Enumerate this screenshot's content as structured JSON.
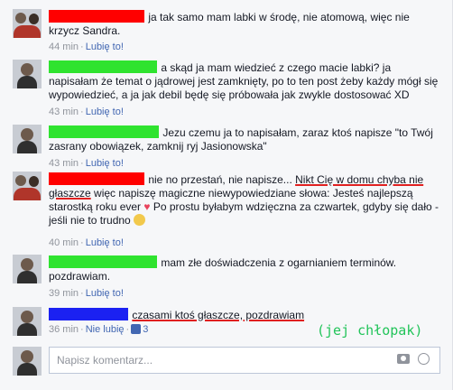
{
  "comments": [
    {
      "text": "ja tak samo mam labki w środę, nie atomową, więc nie krzycz Sandra.",
      "time": "44 min",
      "like_label": "Lubię to!"
    },
    {
      "text": "a skąd ja mam wiedzieć z czego macie labki? ja napisałam że temat o jądrowej jest zamknięty, po to ten post żeby każdy mógł się wypowiedzieć, a ja jak debil będę się próbowała jak zwykle dostosować XD",
      "time": "43 min",
      "like_label": "Lubię to!"
    },
    {
      "text": "Jezu czemu ja to napisałam, zaraz ktoś napisze \"to Twój zasrany obowiązek, zamknij ryj Jasionowska\"",
      "time": "43 min",
      "like_label": "Lubię to!"
    },
    {
      "text_before": "nie no przestań, nie napisze... ",
      "text_underlined": "Nikt Cię w domu chyba nie głaszcze",
      "text_after": " więc napiszę magiczne niewypowiedziane słowa: Jesteś najlepszą starostką roku ever",
      "text_after_heart": " Po prostu byłabym wdzięczna za czwartek, gdyby się dało - jeśli nie to trudno",
      "time": "40 min",
      "like_label": "Lubię to!"
    },
    {
      "text": "mam złe doświadczenia z ogarnianiem terminów. pozdrawiam.",
      "time": "39 min",
      "like_label": "Lubię to!"
    },
    {
      "text": "czasami ktoś głaszcze, pozdrawiam",
      "time": "36 min",
      "unlike_label": "Nie lubię",
      "likes_count": "3"
    }
  ],
  "annotation": "(jej chłopak)",
  "composer": {
    "placeholder": "Napisz komentarz..."
  },
  "icons": {
    "camera": "camera-icon",
    "emoji": "emoji-icon",
    "heart": "heart-icon",
    "thumb": "thumbs-up-icon"
  },
  "colors": {
    "link": "#4267b2",
    "meta": "#90949c",
    "censor_red": "#ff0000",
    "censor_green": "#2fe32f",
    "censor_blue": "#1b21f2",
    "annotation": "#22c45a"
  }
}
